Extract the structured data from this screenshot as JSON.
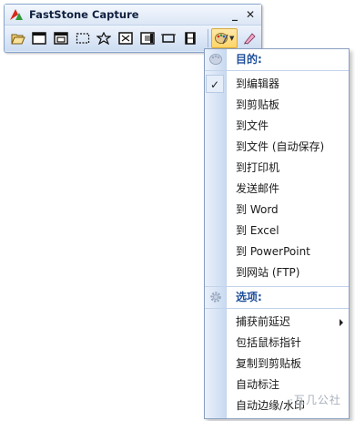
{
  "window": {
    "title": "FastStone Capture",
    "minimize_label": "_",
    "close_label": "✕"
  },
  "toolbar": {
    "tools": [
      {
        "name": "open-file-icon"
      },
      {
        "name": "capture-active-window-icon"
      },
      {
        "name": "capture-window-object-icon"
      },
      {
        "name": "capture-rectangle-icon"
      },
      {
        "name": "capture-freehand-icon"
      },
      {
        "name": "capture-fullscreen-icon"
      },
      {
        "name": "capture-scrolling-icon"
      },
      {
        "name": "capture-fixed-region-icon"
      },
      {
        "name": "screen-recorder-icon"
      }
    ],
    "output_dropdown_arrow": "▼"
  },
  "menu": {
    "destination_header": "目的:",
    "destinations": [
      {
        "label": "到编辑器",
        "checked": true
      },
      {
        "label": "到剪贴板",
        "checked": false
      },
      {
        "label": "到文件",
        "checked": false
      },
      {
        "label": "到文件 (自动保存)",
        "checked": false
      },
      {
        "label": "到打印机",
        "checked": false
      },
      {
        "label": "发送邮件",
        "checked": false
      },
      {
        "label": "到 Word",
        "checked": false
      },
      {
        "label": "到 Excel",
        "checked": false
      },
      {
        "label": "到 PowerPoint",
        "checked": false
      },
      {
        "label": "到网站 (FTP)",
        "checked": false
      }
    ],
    "check_mark": "✓",
    "options_header": "选项:",
    "options": [
      {
        "label": "捕获前延迟",
        "has_submenu": true
      },
      {
        "label": "包括鼠标指针",
        "has_submenu": false
      },
      {
        "label": "复制到剪贴板",
        "has_submenu": false
      },
      {
        "label": "自动标注",
        "has_submenu": false
      },
      {
        "label": "自动边缘/水印",
        "has_submenu": false
      }
    ]
  },
  "watermark": "·瓦几公社",
  "colors": {
    "accent_header": "#1f4f9c",
    "toolbar_bg": "#dfe9f7",
    "active_tool": "#ffd56a",
    "logo_red": "#d8281c",
    "logo_green": "#2f9a3a"
  }
}
